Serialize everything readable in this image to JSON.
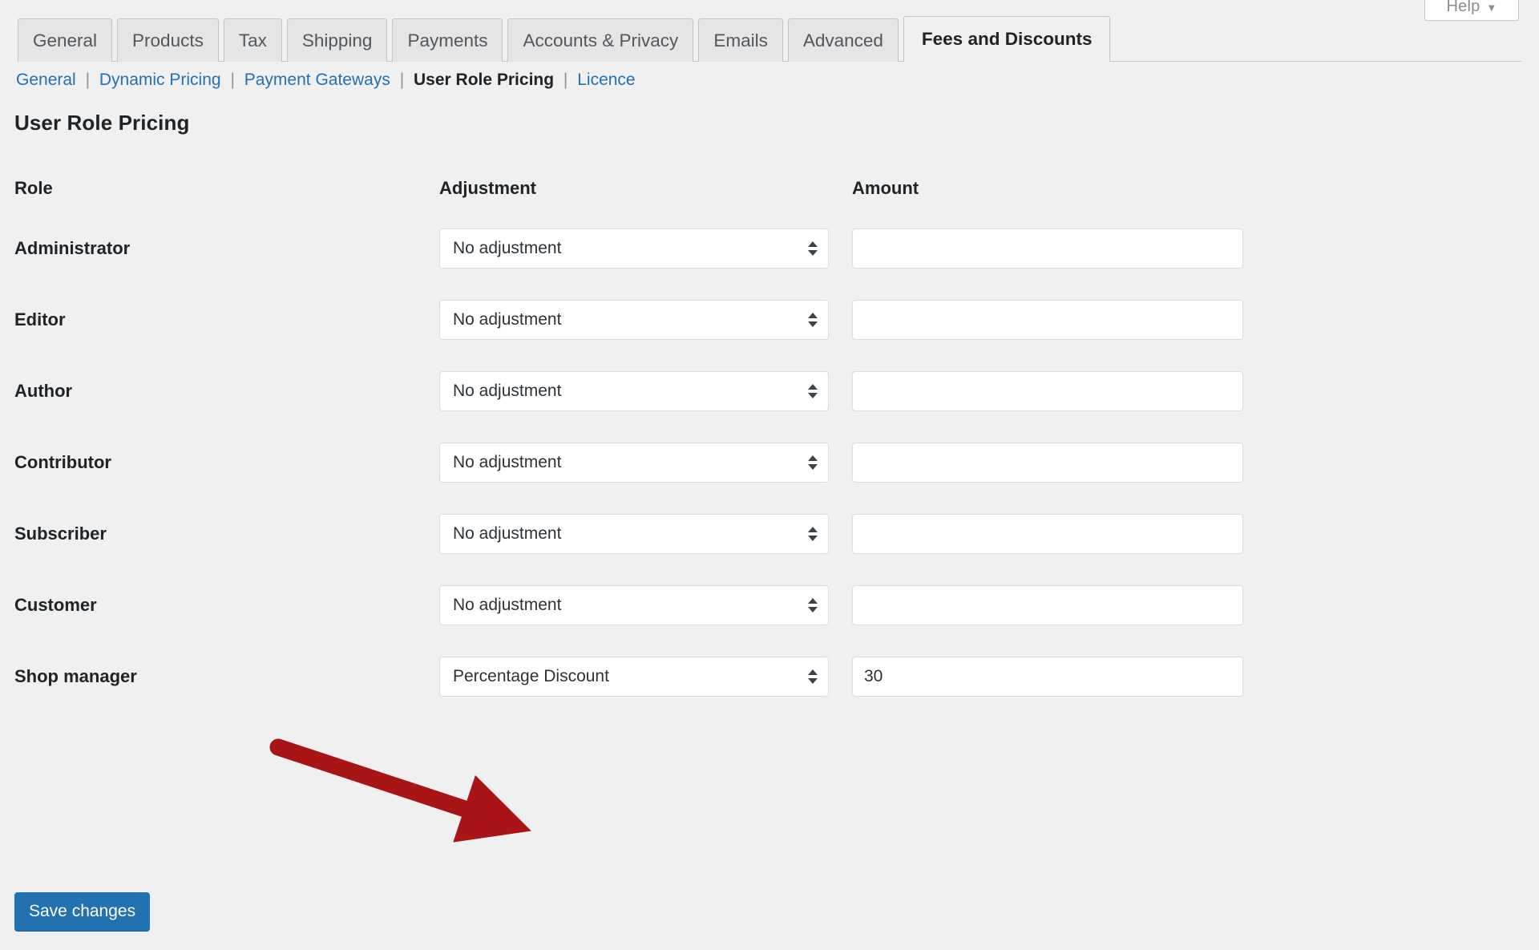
{
  "help": {
    "label": "Help",
    "caret": "▼",
    "icon": "chevron-down-icon"
  },
  "tabs": [
    {
      "label": "General",
      "active": false
    },
    {
      "label": "Products",
      "active": false
    },
    {
      "label": "Tax",
      "active": false
    },
    {
      "label": "Shipping",
      "active": false
    },
    {
      "label": "Payments",
      "active": false
    },
    {
      "label": "Accounts & Privacy",
      "active": false
    },
    {
      "label": "Emails",
      "active": false
    },
    {
      "label": "Advanced",
      "active": false
    },
    {
      "label": "Fees and Discounts",
      "active": true
    }
  ],
  "subnav": {
    "items": [
      {
        "label": "General",
        "current": false
      },
      {
        "label": "Dynamic Pricing",
        "current": false
      },
      {
        "label": "Payment Gateways",
        "current": false
      },
      {
        "label": "User Role Pricing",
        "current": true
      },
      {
        "label": "Licence",
        "current": false
      }
    ],
    "separator": "|"
  },
  "page_title": "User Role Pricing",
  "table": {
    "headers": {
      "role": "Role",
      "adjustment": "Adjustment",
      "amount": "Amount"
    },
    "rows": [
      {
        "role": "Administrator",
        "adjustment": "No adjustment",
        "amount": ""
      },
      {
        "role": "Editor",
        "adjustment": "No adjustment",
        "amount": ""
      },
      {
        "role": "Author",
        "adjustment": "No adjustment",
        "amount": ""
      },
      {
        "role": "Contributor",
        "adjustment": "No adjustment",
        "amount": ""
      },
      {
        "role": "Subscriber",
        "adjustment": "No adjustment",
        "amount": ""
      },
      {
        "role": "Customer",
        "adjustment": "No adjustment",
        "amount": ""
      },
      {
        "role": "Shop manager",
        "adjustment": "Percentage Discount",
        "amount": "30"
      }
    ]
  },
  "save_button": {
    "label": "Save changes"
  },
  "annotation": {
    "type": "arrow",
    "color": "#a91516",
    "points_to": "shop-manager-adjustment-select"
  },
  "colors": {
    "page_background": "#f0f0f1",
    "link": "#2271b1",
    "text": "#1d2327",
    "muted_text": "#50575e",
    "border": "#c3c4c7",
    "input_border": "#dcdcde",
    "primary_button": "#2271b1",
    "annotation_red": "#a91516"
  }
}
